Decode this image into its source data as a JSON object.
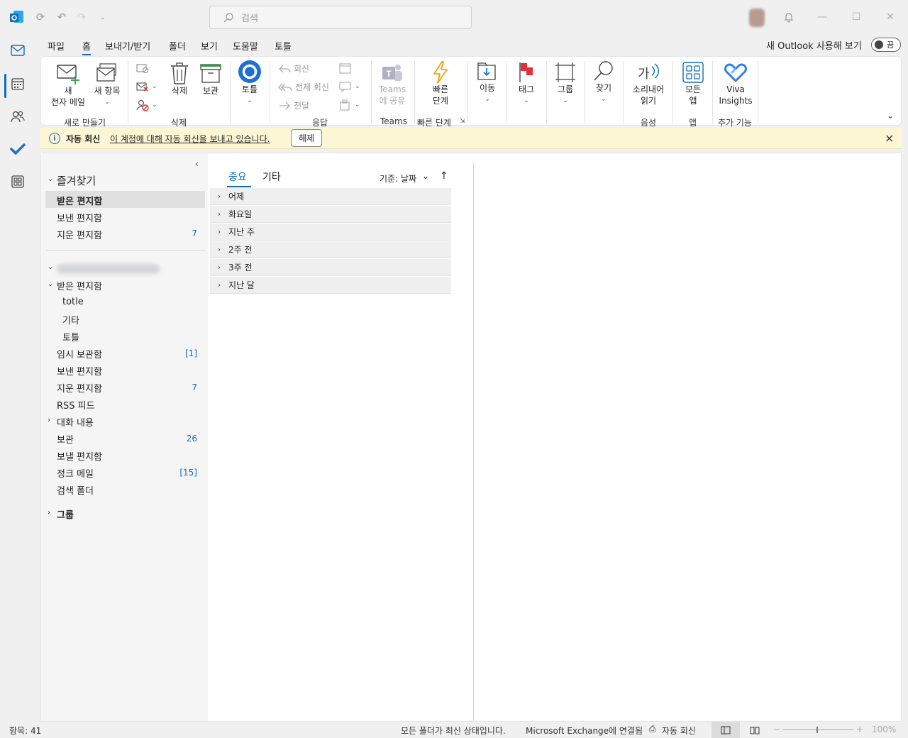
{
  "search": {
    "placeholder": "검색"
  },
  "menu": {
    "items": [
      {
        "label": "파일"
      },
      {
        "label": "홈"
      },
      {
        "label": "보내기/받기"
      },
      {
        "label": "폴더"
      },
      {
        "label": "보기"
      },
      {
        "label": "도움말"
      },
      {
        "label": "토틀"
      }
    ],
    "active_index": 1,
    "try_new": "새 Outlook 사용해 보기",
    "toggle_label": "끔"
  },
  "ribbon": {
    "new_email": "새\n전자 메일",
    "new_items": "새 항목",
    "group_new": "새로 만들기",
    "delete": "삭제",
    "archive": "보관",
    "group_delete": "삭제",
    "totle": "토틀",
    "reply": "회신",
    "reply_all": "전체 회신",
    "forward": "전달",
    "group_respond": "응답",
    "teams_share": "Teams\n에 공유",
    "group_teams": "Teams",
    "quick_steps": "빠른\n단계",
    "group_quick_steps": "빠른 단계",
    "move": "이동",
    "tags": "태그",
    "groups": "그룹",
    "find": "찾기",
    "read_aloud": "소리내어\n읽기",
    "group_voice": "음성",
    "all_apps": "모든\n앱",
    "group_apps": "앱",
    "viva": "Viva\nInsights",
    "group_addins": "추가 기능",
    "read_aloud_icon_text": "가"
  },
  "banner": {
    "title": "자동 회신",
    "text": "이 계정에 대해 자동 회신을 보내고 있습니다.",
    "button": "해제"
  },
  "folders": {
    "favorites_header": "즐겨찾기",
    "favorites": [
      {
        "label": "받은 편지함",
        "count": ""
      },
      {
        "label": "보낸 편지함",
        "count": ""
      },
      {
        "label": "지운 편지함",
        "count": "7"
      }
    ],
    "account_name": "",
    "inbox": "받은 편지함",
    "inbox_children": [
      {
        "label": "totle"
      },
      {
        "label": "기타"
      },
      {
        "label": "토틀"
      }
    ],
    "others": [
      {
        "label": "임시 보관함",
        "count": "[1]"
      },
      {
        "label": "보낸 편지함",
        "count": ""
      },
      {
        "label": "지운 편지함",
        "count": "7"
      },
      {
        "label": "RSS 피드",
        "count": ""
      },
      {
        "label": "대화 내용",
        "count": ""
      },
      {
        "label": "보관",
        "count": "26"
      },
      {
        "label": "보낼 편지함",
        "count": ""
      },
      {
        "label": "정크 메일",
        "count": "[15]"
      },
      {
        "label": "검색 폴더",
        "count": ""
      }
    ],
    "groups": "그룹"
  },
  "list": {
    "tab_focused": "중요",
    "tab_other": "기타",
    "sort_label": "기준: 날짜",
    "groups": [
      {
        "label": "어제"
      },
      {
        "label": "화요일"
      },
      {
        "label": "지난 주"
      },
      {
        "label": "2주 전"
      },
      {
        "label": "3주 전"
      },
      {
        "label": "지난 달"
      }
    ]
  },
  "status": {
    "items_count": "항목: 41",
    "folders_status": "모든 폴더가 최신 상태입니다.",
    "connection": "Microsoft Exchange에 연결됨",
    "auto_reply": "자동 회신",
    "zoom": "100%"
  },
  "colors": {
    "accent": "#0f6cbd",
    "banner_bg": "#fdf6d4",
    "flag": "#e0313c",
    "quick_steps": "#f5a200"
  }
}
